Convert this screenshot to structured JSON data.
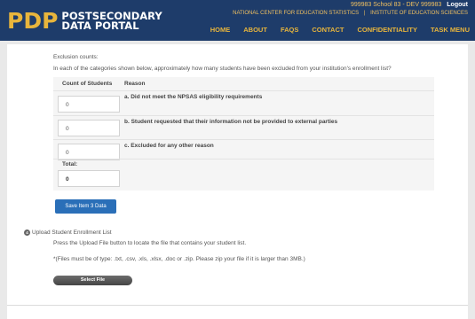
{
  "header": {
    "logo_mark": "PDP",
    "logo_line1": "POSTSECONDARY",
    "logo_line2": "DATA PORTAL",
    "user_info": "999983 School 83 - DEV 999983",
    "logout": "Logout",
    "org_nces": "NATIONAL CENTER FOR EDUCATION STATISTICS",
    "org_sep": "|",
    "org_ies": "INSTITUTE OF EDUCATION SCIENCES",
    "nav": [
      "HOME",
      "ABOUT",
      "FAQS",
      "CONTACT",
      "CONFIDENTIALITY",
      "TASK MENU"
    ]
  },
  "exclusion": {
    "label": "Exclusion counts:",
    "question": "In each of the categories shown below, approximately how many students have been excluded from your institution's enrollment list?",
    "col_count": "Count of Students",
    "col_reason": "Reason",
    "rows": [
      {
        "value": "0",
        "reason": "a. Did not meet the NPSAS eligibility requirements"
      },
      {
        "value": "0",
        "reason": "b. Student requested that their information not be provided to external parties"
      },
      {
        "value": "0",
        "reason": "c. Excluded for any other reason"
      }
    ],
    "total_label": "Total:",
    "total_value": "0",
    "save_button": "Save Item 3 Data"
  },
  "upload": {
    "step": "4",
    "title": "Upload Student Enrollment List",
    "instructions": "Press the Upload File button to locate the file that contains your student list.",
    "note": "*(Files must be of type: .txt, .csv, .xls, .xlsx, .doc or .zip. Please zip your file if it is larger than 3MB.)",
    "select_button": "Select File"
  },
  "colors": {
    "header_bg": "#1e3c6a",
    "logo_gold": "#e8b53c",
    "save_blue": "#2a6fb8"
  }
}
